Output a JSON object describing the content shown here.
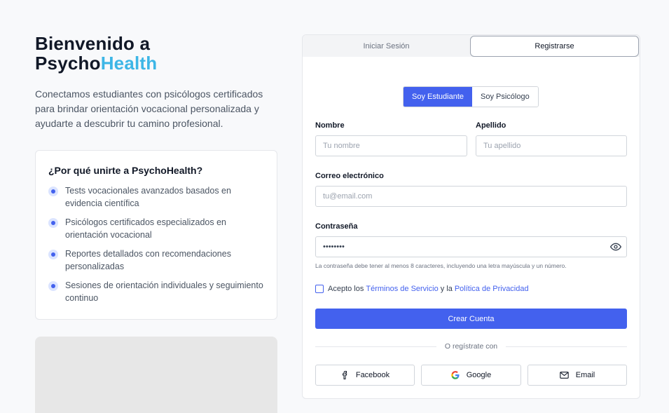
{
  "hero": {
    "title_line1": "Bienvenido a",
    "title_part1": "Psycho",
    "title_part2": "Health",
    "description": "Conectamos estudiantes con psicólogos certificados para brindar orientación vocacional personalizada y ayudarte a descubrir tu camino profesional."
  },
  "why": {
    "title": "¿Por qué unirte a PsychoHealth?",
    "items": [
      "Tests vocacionales avanzados basados en evidencia científica",
      "Psicólogos certificados especializados en orientación vocacional",
      "Reportes detallados con recomendaciones personalizadas",
      "Sesiones de orientación individuales y seguimiento continuo"
    ]
  },
  "tabs": {
    "login": "Iniciar Sesión",
    "register": "Registrarse"
  },
  "roles": {
    "student": "Soy Estudiante",
    "psychologist": "Soy Psicólogo"
  },
  "form": {
    "first_name_label": "Nombre",
    "first_name_placeholder": "Tu nombre",
    "last_name_label": "Apellido",
    "last_name_placeholder": "Tu apellido",
    "email_label": "Correo electrónico",
    "email_placeholder": "tu@email.com",
    "password_label": "Contraseña",
    "password_value": "••••••••",
    "password_hint": "La contraseña debe tener al menos 8 caracteres, incluyendo una letra mayúscula y un número.",
    "terms_prefix": "Acepto los",
    "terms_link": "Términos de Servicio",
    "terms_and": "y la",
    "privacy_link": "Política de Privacidad",
    "submit": "Crear Cuenta",
    "divider": "O regístrate con"
  },
  "social": {
    "facebook": "Facebook",
    "google": "Google",
    "email": "Email"
  },
  "colors": {
    "primary": "#4361ee",
    "accent": "#3db6e6"
  }
}
